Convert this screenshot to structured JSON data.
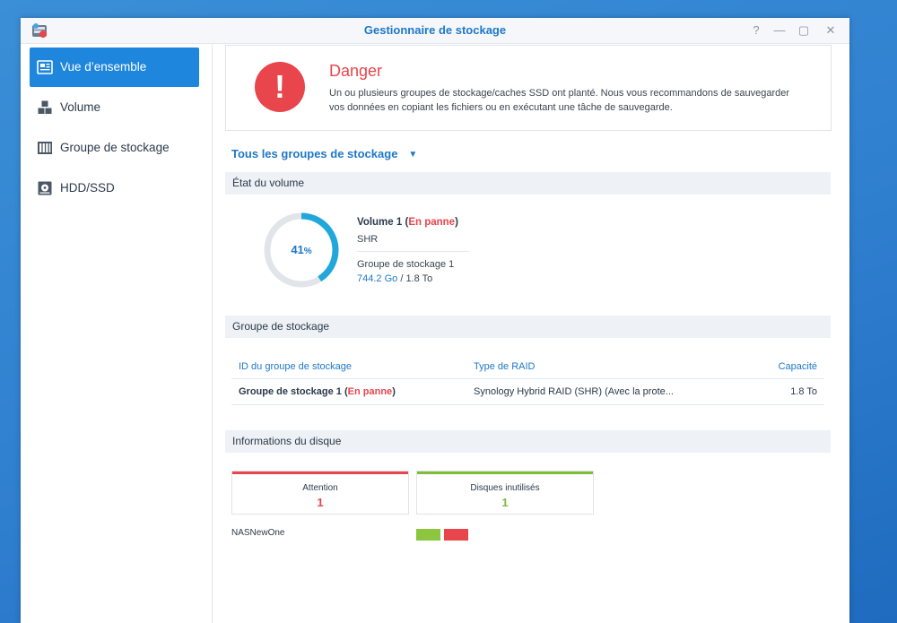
{
  "window": {
    "title": "Gestionnaire de stockage",
    "controls": {
      "help": "?",
      "minimize": "—",
      "maximize": "▢",
      "close": "✕"
    }
  },
  "sidebar": {
    "items": [
      {
        "label": "Vue d’ensemble",
        "icon": "overview-icon",
        "active": true
      },
      {
        "label": "Volume",
        "icon": "volume-cubes-icon",
        "active": false
      },
      {
        "label": "Groupe de stockage",
        "icon": "storage-pool-icon",
        "active": false
      },
      {
        "label": "HDD/SSD",
        "icon": "hdd-icon",
        "active": false
      }
    ]
  },
  "alert": {
    "symbol": "!",
    "title": "Danger",
    "message": "Un ou plusieurs groupes de stockage/caches SSD ont planté. Nous vous recommandons de sauvegarder vos données en copiant les fichiers ou en exécutant une tâche de sauvegarde."
  },
  "pool_filter": {
    "label": "Tous les groupes de stockage",
    "caret": "▼"
  },
  "volume_section": {
    "header": "État du volume",
    "usage_percent": 41,
    "usage_number": "41",
    "usage_unit": "%",
    "name": "Volume 1",
    "status": "En panne",
    "type": "SHR",
    "pool": "Groupe de stockage 1",
    "used": "744.2 Go",
    "total": "1.8 To"
  },
  "pool_section": {
    "header": "Groupe de stockage",
    "columns": {
      "id": "ID du groupe de stockage",
      "raid": "Type de RAID",
      "capacity": "Capacité"
    },
    "rows": [
      {
        "name": "Groupe de stockage 1",
        "status": "En panne",
        "raid": "Synology Hybrid RAID (SHR) (Avec la prote...",
        "capacity": "1.8 To"
      }
    ]
  },
  "disk_section": {
    "header": "Informations du disque",
    "cards": [
      {
        "label": "Attention",
        "count": "1",
        "color": "#e8454c"
      },
      {
        "label": "Disques inutilisés",
        "count": "1",
        "color": "#7dbd3a"
      }
    ],
    "nas_name": "NASNewOne",
    "disk_slots": [
      {
        "status": "normal",
        "color": "#8cc63f"
      },
      {
        "status": "warning",
        "color": "#e8454c"
      }
    ]
  },
  "colors": {
    "accent": "#1e86dc",
    "danger": "#e8454c",
    "ok": "#7dbd3a",
    "ring_track": "#e1e5ea"
  }
}
